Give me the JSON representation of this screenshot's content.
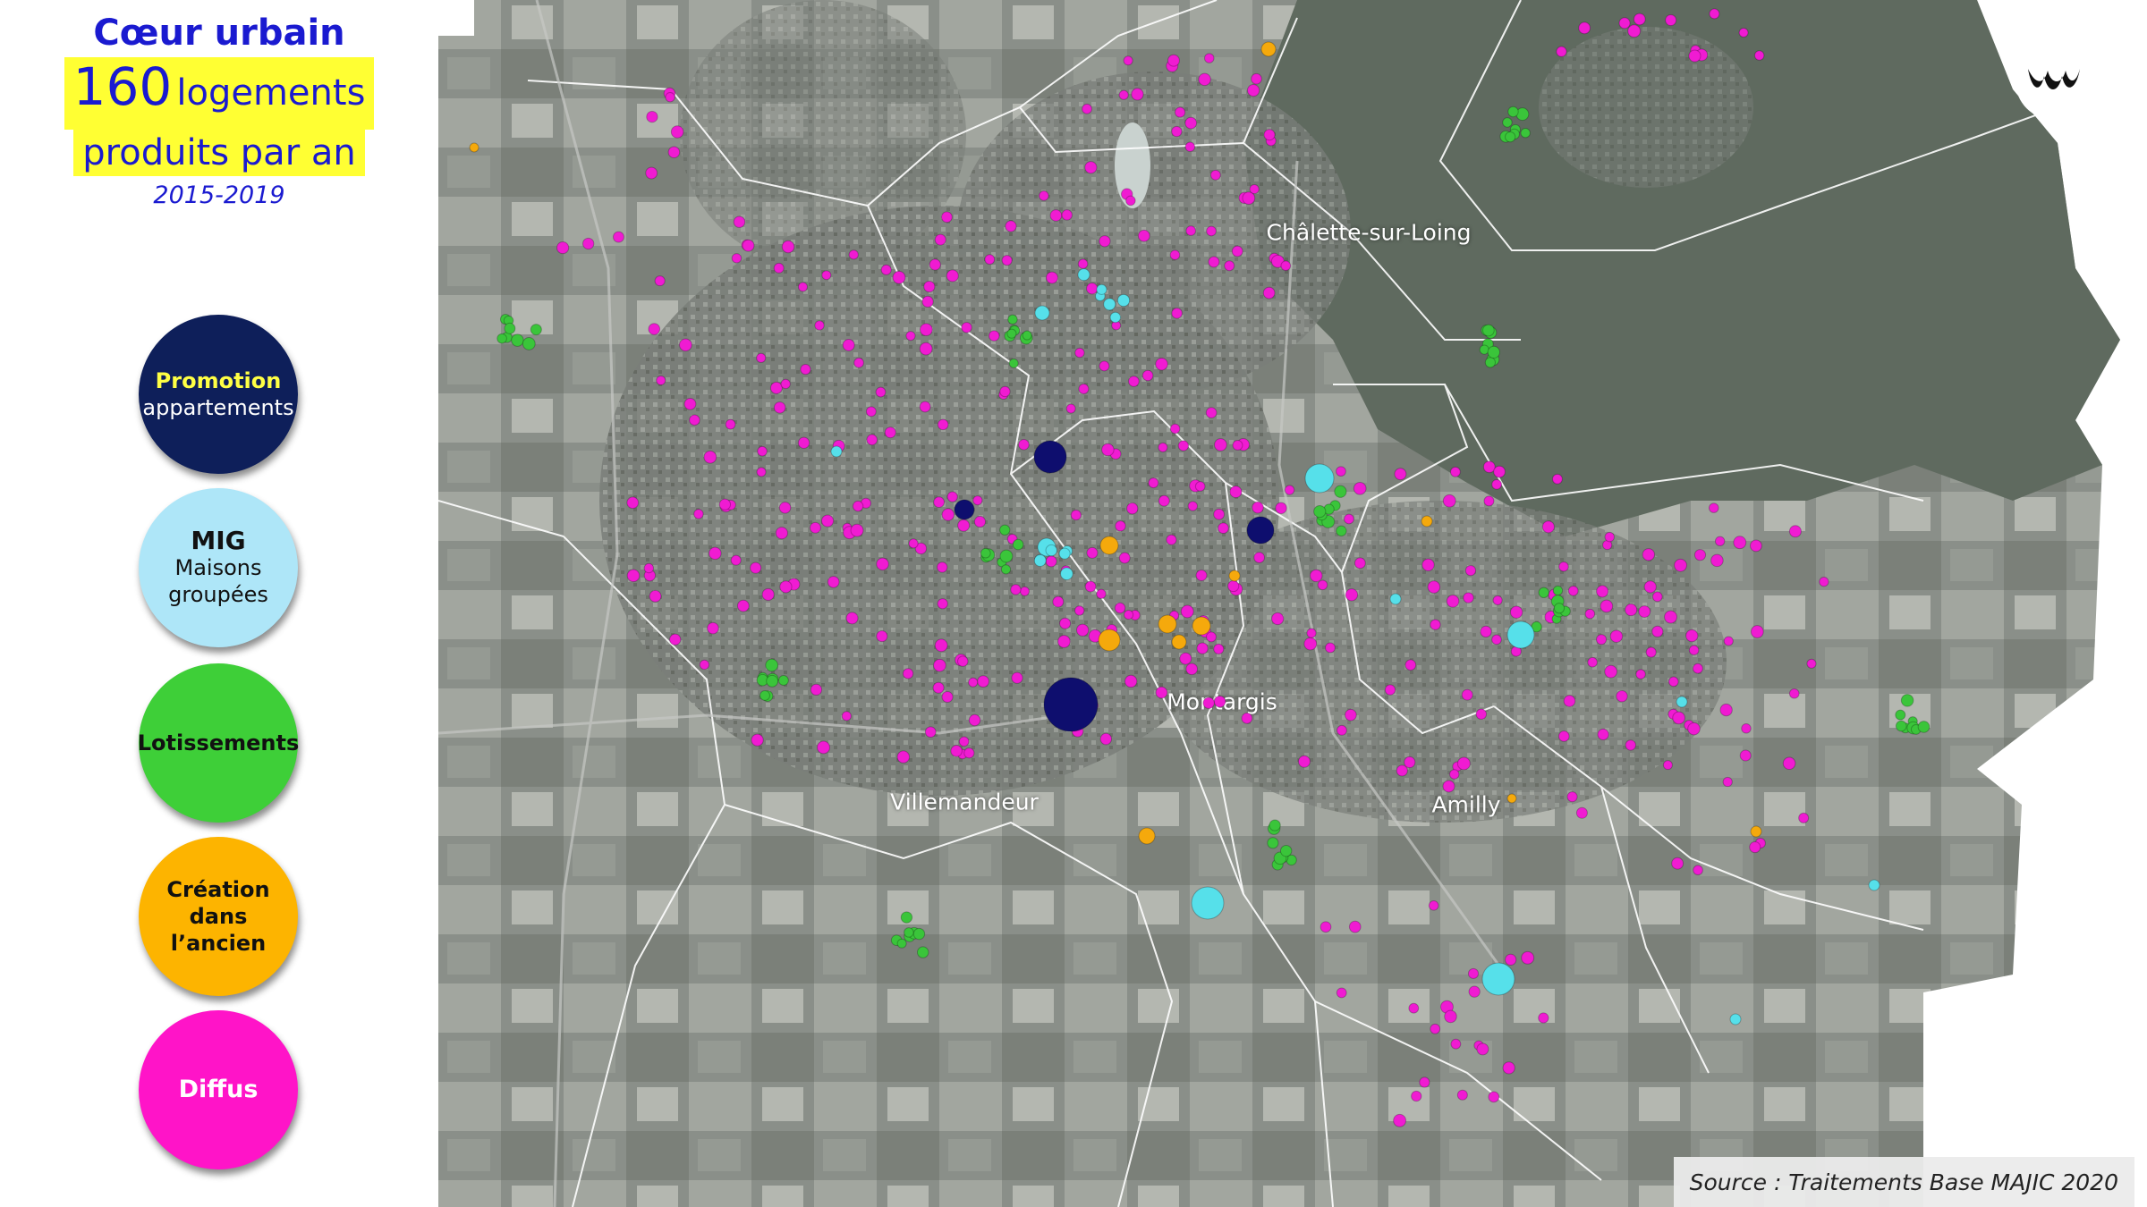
{
  "title": {
    "line1": "Cœur urbain",
    "count": "160",
    "count_unit": "logements",
    "line3": "produits par an",
    "period": "2015-2019"
  },
  "legend": [
    {
      "lines": [
        "Promotion",
        "appartements"
      ],
      "fill": "#0e1f5a",
      "text_colors": [
        "#ffff44",
        "#ffffff"
      ]
    },
    {
      "lines": [
        "MIG",
        "Maisons",
        "groupées"
      ],
      "fill": "#aee6f8",
      "text_colors": [
        "#111111",
        "#111111",
        "#111111"
      ]
    },
    {
      "lines": [
        "Lotissements"
      ],
      "fill": "#3ecf38",
      "text_colors": [
        "#111111"
      ]
    },
    {
      "lines": [
        "Création",
        "dans",
        "l’ancien"
      ],
      "fill": "#fdb400",
      "text_colors": [
        "#111111",
        "#111111",
        "#111111"
      ]
    },
    {
      "lines": [
        "Diffus"
      ],
      "fill": "#ff14c8",
      "text_colors": [
        "#ffffff"
      ]
    }
  ],
  "map": {
    "places": [
      "Châlette-sur-Loing",
      "Montargis",
      "Villemandeur",
      "Amilly"
    ],
    "source": "Source : Traitements Base MAJIC 2020",
    "logo_icon": "wave-logo-icon"
  },
  "colors": {
    "promotion": "#0e0e6e",
    "mig": "#56e0ea",
    "lotissements": "#3ac53a",
    "creation": "#f5a90c",
    "diffus": "#f01bd2",
    "title_blue": "#1a1ad0",
    "highlight": "#ffff33"
  }
}
